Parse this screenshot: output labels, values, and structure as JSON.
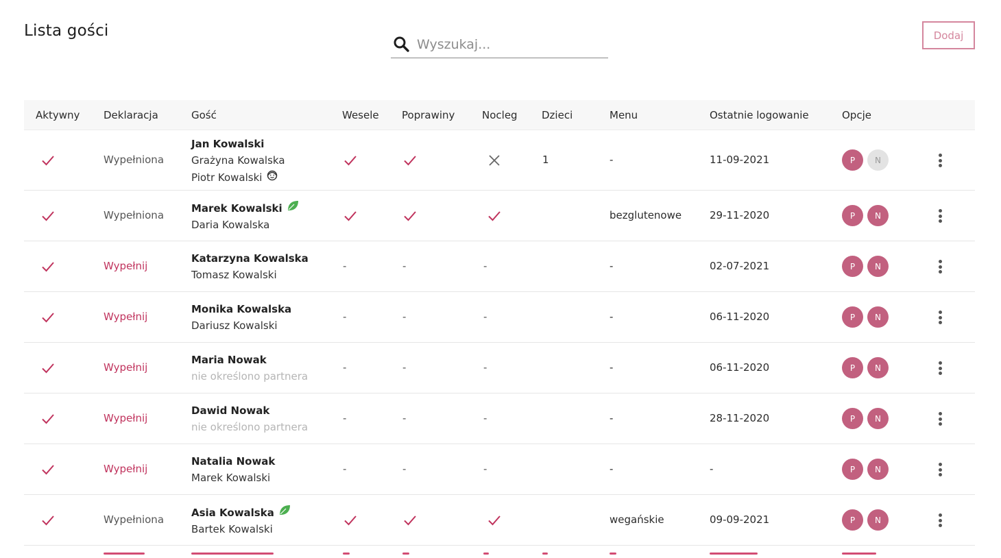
{
  "page": {
    "title": "Lista gości"
  },
  "search": {
    "placeholder": "Wyszukaj..."
  },
  "toolbar": {
    "add_label": "Dodaj"
  },
  "table": {
    "headers": [
      "Aktywny",
      "Deklaracja",
      "Gość",
      "Wesele",
      "Poprawiny",
      "Nocleg",
      "Dzieci",
      "Menu",
      "Ostatnie logowanie",
      "Opcje"
    ],
    "rows": [
      {
        "active": true,
        "declaration": "Wypełniona",
        "declaration_done": true,
        "guest": "Jan Kowalski",
        "guest_leaf": false,
        "partners": [
          "Grażyna Kowalska",
          "Piotr Kowalski"
        ],
        "child_icon_on": 1,
        "wesele": "check",
        "poprawiny": "check",
        "nocleg": "cross",
        "dzieci": "1",
        "menu": "-",
        "last_login": "11-09-2021",
        "p_badge": "P",
        "n_badge": "N",
        "n_active": false
      },
      {
        "active": true,
        "declaration": "Wypełniona",
        "declaration_done": true,
        "guest": "Marek Kowalski",
        "guest_leaf": true,
        "partners": [
          "Daria Kowalska"
        ],
        "wesele": "check",
        "poprawiny": "check",
        "nocleg": "check",
        "dzieci": "",
        "menu": "bezglutenowe",
        "last_login": "29-11-2020",
        "p_badge": "P",
        "n_badge": "N",
        "n_active": true
      },
      {
        "active": true,
        "declaration": "Wypełnij",
        "declaration_done": false,
        "guest": "Katarzyna Kowalska",
        "guest_leaf": false,
        "partners": [
          "Tomasz Kowalski"
        ],
        "wesele": "-",
        "poprawiny": "-",
        "nocleg": "-",
        "dzieci": "",
        "menu": "-",
        "last_login": "02-07-2021",
        "p_badge": "P",
        "n_badge": "N",
        "n_active": true
      },
      {
        "active": true,
        "declaration": "Wypełnij",
        "declaration_done": false,
        "guest": "Monika Kowalska",
        "guest_leaf": false,
        "partners": [
          "Dariusz Kowalski"
        ],
        "wesele": "-",
        "poprawiny": "-",
        "nocleg": "-",
        "dzieci": "",
        "menu": "-",
        "last_login": "06-11-2020",
        "p_badge": "P",
        "n_badge": "N",
        "n_active": true
      },
      {
        "active": true,
        "declaration": "Wypełnij",
        "declaration_done": false,
        "guest": "Maria Nowak",
        "guest_leaf": false,
        "partners": [],
        "no_partner": "nie określono partnera",
        "wesele": "-",
        "poprawiny": "-",
        "nocleg": "-",
        "dzieci": "",
        "menu": "-",
        "last_login": "06-11-2020",
        "p_badge": "P",
        "n_badge": "N",
        "n_active": true
      },
      {
        "active": true,
        "declaration": "Wypełnij",
        "declaration_done": false,
        "guest": "Dawid Nowak",
        "guest_leaf": false,
        "partners": [],
        "no_partner": "nie określono partnera",
        "wesele": "-",
        "poprawiny": "-",
        "nocleg": "-",
        "dzieci": "",
        "menu": "-",
        "last_login": "28-11-2020",
        "p_badge": "P",
        "n_badge": "N",
        "n_active": true
      },
      {
        "active": true,
        "declaration": "Wypełnij",
        "declaration_done": false,
        "guest": "Natalia Nowak",
        "guest_leaf": false,
        "partners": [
          "Marek Kowalski"
        ],
        "wesele": "-",
        "poprawiny": "-",
        "nocleg": "-",
        "dzieci": "",
        "menu": "-",
        "last_login": "-",
        "p_badge": "P",
        "n_badge": "N",
        "n_active": true
      },
      {
        "active": true,
        "declaration": "Wypełniona",
        "declaration_done": true,
        "guest": "Asia Kowalska",
        "guest_leaf": true,
        "partners": [
          "Bartek Kowalski"
        ],
        "wesele": "check",
        "poprawiny": "check",
        "nocleg": "check",
        "dzieci": "",
        "menu": "wegańskie",
        "last_login": "09-09-2021",
        "p_badge": "P",
        "n_badge": "N",
        "n_active": true
      }
    ]
  },
  "colors": {
    "accent": "#c0335d",
    "badge": "#c2607f",
    "badge_off": "#e3e3e3",
    "leaf": "#4caf50",
    "button_border": "#d4869d"
  },
  "icons": {
    "search": "search-icon",
    "check": "check-icon",
    "cross": "cross-icon",
    "leaf": "leaf-icon",
    "child": "child-face-icon",
    "more": "more-vertical-icon"
  }
}
